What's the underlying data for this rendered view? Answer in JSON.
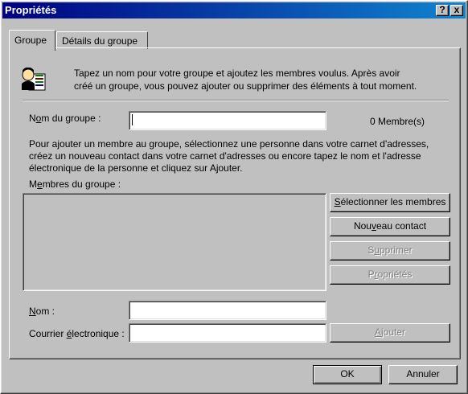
{
  "window": {
    "title": "Propriétés",
    "help_label": "?",
    "close_label": "x"
  },
  "tabs": [
    {
      "label": "Groupe",
      "active": true
    },
    {
      "label": "Détails du groupe",
      "active": false
    }
  ],
  "intro": {
    "text_line1": "Tapez un nom pour votre groupe et ajoutez les membres voulus. Après avoir",
    "text_line2": "créé un groupe, vous pouvez ajouter ou supprimer des éléments à tout moment."
  },
  "group_name": {
    "label_pre": "N",
    "label_u": "o",
    "label_post": "m du groupe :",
    "value": "",
    "member_count": "0 Membre(s)"
  },
  "help_text": {
    "line1": "Pour ajouter un membre au groupe, sélectionnez une personne dans votre carnet d'adresses,",
    "line2": "créez un nouveau contact dans votre carnet d'adresses ou encore tapez le nom et l'adresse",
    "line3": "électronique de la personne et cliquez sur Ajouter."
  },
  "members": {
    "label_pre": "M",
    "label_u": "e",
    "label_post": "mbres du groupe :",
    "items": []
  },
  "buttons": {
    "select_pre": "",
    "select_u": "S",
    "select_post": "électionner les membres",
    "new_pre": "Nou",
    "new_u": "v",
    "new_post": "eau contact",
    "delete_pre": "S",
    "delete_u": "u",
    "delete_post": "pprimer",
    "properties_pre": "P",
    "properties_u": "r",
    "properties_post": "opriétés",
    "add_pre": "",
    "add_u": "A",
    "add_post": "jouter",
    "ok": "OK",
    "cancel": "Annuler"
  },
  "contact_form": {
    "name_pre": "",
    "name_u": "N",
    "name_post": "om :",
    "name_value": "",
    "email_pre": "Courrier ",
    "email_u": "é",
    "email_post": "lectronique :",
    "email_value": ""
  }
}
